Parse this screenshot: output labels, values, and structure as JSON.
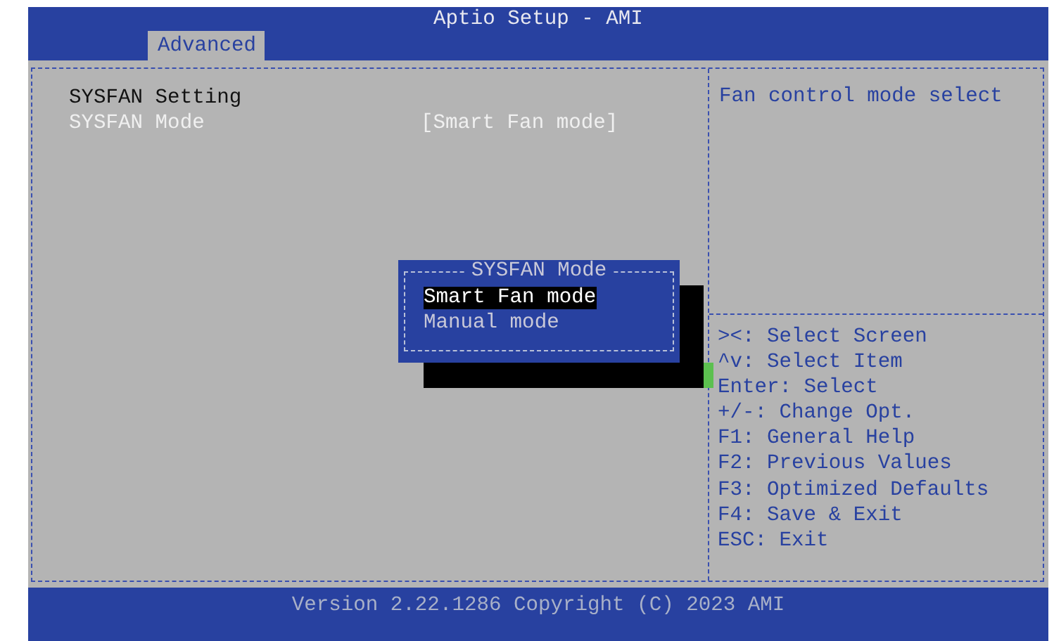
{
  "window": {
    "title": "Aptio Setup - AMI"
  },
  "tabs": [
    {
      "label": "Advanced",
      "selected": true
    }
  ],
  "settings": [
    {
      "kind": "heading",
      "label": "SYSFAN Setting"
    },
    {
      "kind": "option",
      "label": "SYSFAN Mode",
      "value": "[Smart Fan mode]",
      "selected": true
    }
  ],
  "help_text": "Fan control mode select",
  "key_hints": [
    "><: Select Screen",
    "^v: Select Item",
    "Enter: Select",
    "+/-: Change Opt.",
    "F1: General Help",
    "F2: Previous Values",
    "F3: Optimized Defaults",
    "F4: Save & Exit",
    "ESC: Exit"
  ],
  "popup": {
    "title": "SYSFAN Mode",
    "options": [
      {
        "label": "Smart Fan mode",
        "selected": true
      },
      {
        "label": "Manual mode",
        "selected": false
      }
    ]
  },
  "status_bar": "Version 2.22.1286 Copyright (C) 2023 AMI"
}
